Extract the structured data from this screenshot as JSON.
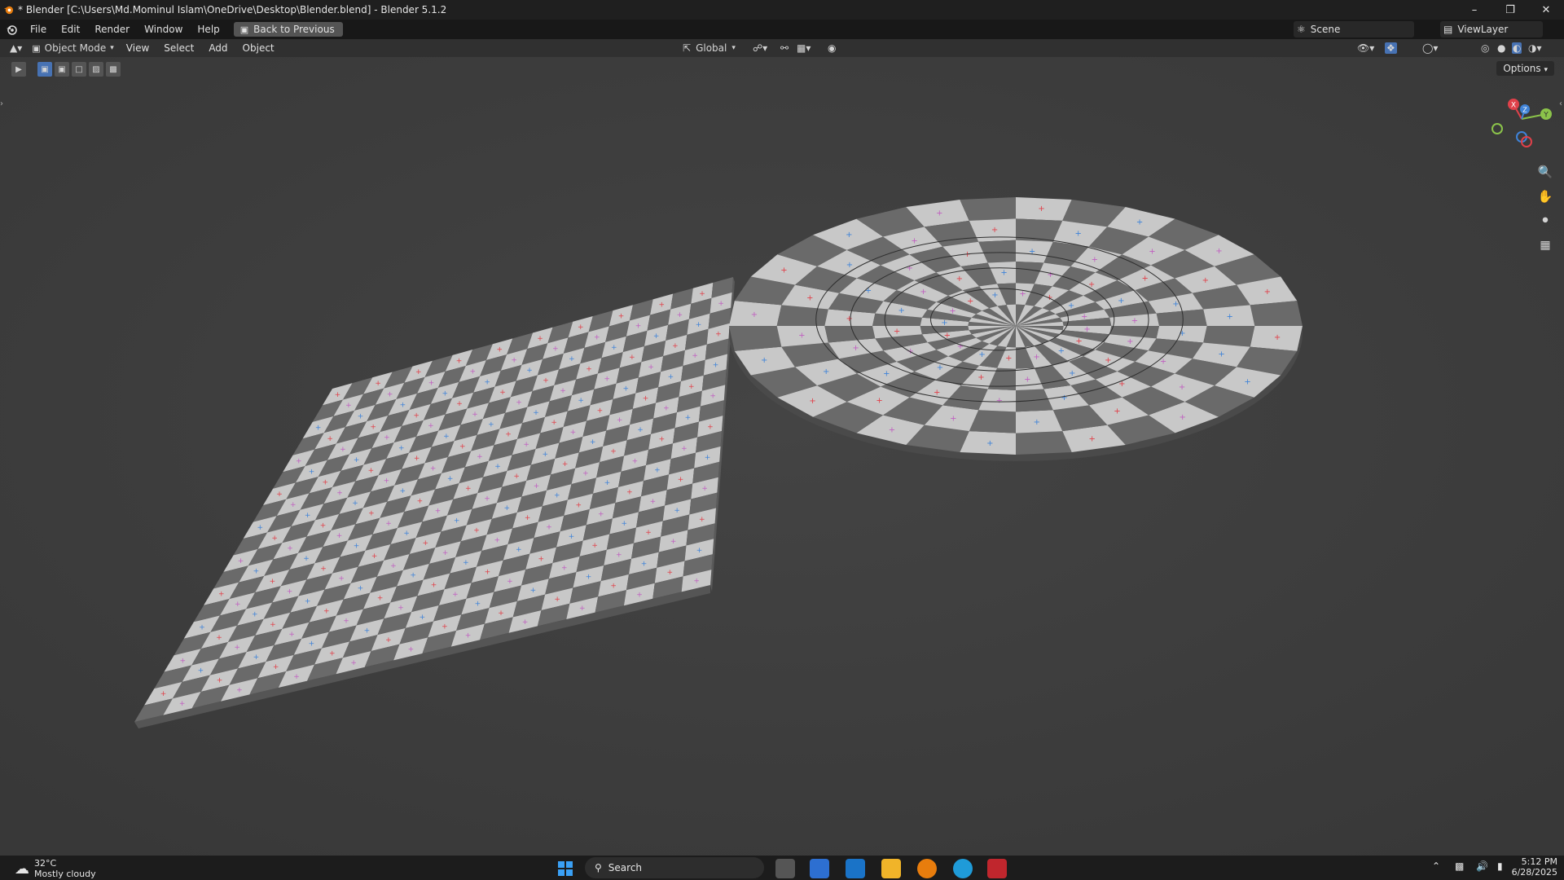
{
  "window": {
    "title": "* Blender [C:\\Users\\Md.Mominul Islam\\OneDrive\\Desktop\\Blender.blend] - Blender 5.1.2"
  },
  "menubar": {
    "items": [
      "File",
      "Edit",
      "Render",
      "Window",
      "Help"
    ],
    "back_button": "Back to Previous",
    "scene": "Scene",
    "view_layer": "ViewLayer"
  },
  "header": {
    "mode": "Object Mode",
    "menus": [
      "View",
      "Select",
      "Add",
      "Object"
    ],
    "transform_orientation": "Global"
  },
  "viewport": {
    "options_label": "Options",
    "gizmo_axes": [
      "X",
      "Y",
      "Z"
    ],
    "colors": {
      "background": "#3c3c3c",
      "checker_light": "#c8c8c8",
      "checker_dark": "#6a6a6a",
      "axis_x": "#e0414a",
      "axis_y": "#8bc34a",
      "axis_z": "#3f83d8"
    }
  },
  "taskbar": {
    "weather_temp": "32°C",
    "weather_desc": "Mostly cloudy",
    "search_placeholder": "Search",
    "time": "5:12 PM",
    "date": "6/28/2025"
  }
}
